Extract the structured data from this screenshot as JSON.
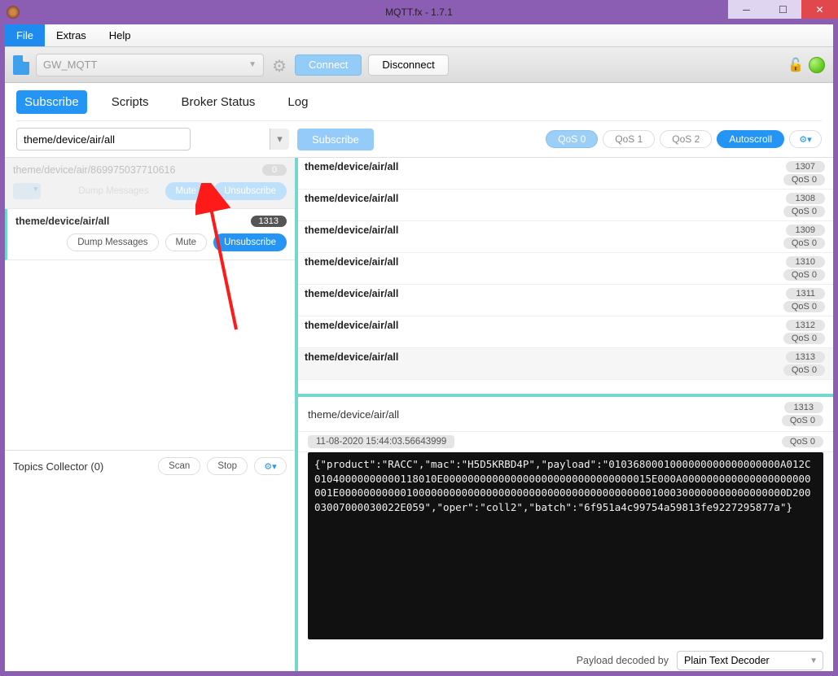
{
  "window": {
    "title": "MQTT.fx - 1.7.1"
  },
  "menu": {
    "file": "File",
    "extras": "Extras",
    "help": "Help"
  },
  "conn": {
    "profile": "GW_MQTT",
    "connect": "Connect",
    "disconnect": "Disconnect"
  },
  "tabs": {
    "subscribe": "Subscribe",
    "scripts": "Scripts",
    "broker": "Broker Status",
    "log": "Log"
  },
  "subscribe_bar": {
    "topic_value": "theme/device/air/all",
    "subscribe_btn": "Subscribe",
    "qos0": "QoS 0",
    "qos1": "QoS 1",
    "qos2": "QoS 2",
    "autoscroll": "Autoscroll"
  },
  "subs": [
    {
      "topic": "theme/device/air/869975037710616",
      "count": "0",
      "dump": "Dump Messages",
      "mute": "Mute",
      "unsub": "Unsubscribe"
    },
    {
      "topic": "theme/device/air/all",
      "count": "1313",
      "dump": "Dump Messages",
      "mute": "Mute",
      "unsub": "Unsubscribe"
    }
  ],
  "topics_collector": {
    "title": "Topics Collector (0)",
    "scan": "Scan",
    "stop": "Stop"
  },
  "messages": [
    {
      "topic": "theme/device/air/all",
      "id": "1307",
      "qos": "QoS 0"
    },
    {
      "topic": "theme/device/air/all",
      "id": "1308",
      "qos": "QoS 0"
    },
    {
      "topic": "theme/device/air/all",
      "id": "1309",
      "qos": "QoS 0"
    },
    {
      "topic": "theme/device/air/all",
      "id": "1310",
      "qos": "QoS 0"
    },
    {
      "topic": "theme/device/air/all",
      "id": "1311",
      "qos": "QoS 0"
    },
    {
      "topic": "theme/device/air/all",
      "id": "1312",
      "qos": "QoS 0"
    },
    {
      "topic": "theme/device/air/all",
      "id": "1313",
      "qos": "QoS 0"
    }
  ],
  "detail": {
    "topic": "theme/device/air/all",
    "id": "1313",
    "qos": "QoS 0",
    "timestamp": "11-08-2020  15:44:03.56643999",
    "payload": "{\"product\":\"RACC\",\"mac\":\"H5D5KRBD4P\",\"payload\":\"0103680001000000000000000000A012C01040000000000118010E0000000000000000000000000000000015E000A000000000000000000000001E0000000000010000000000000000000000000000000000000001000300000000000000000D20003007000030022E059\",\"oper\":\"coll2\",\"batch\":\"6f951a4c99754a59813fe9227295877a\"}"
  },
  "footer": {
    "label": "Payload decoded by",
    "decoder": "Plain Text Decoder"
  }
}
